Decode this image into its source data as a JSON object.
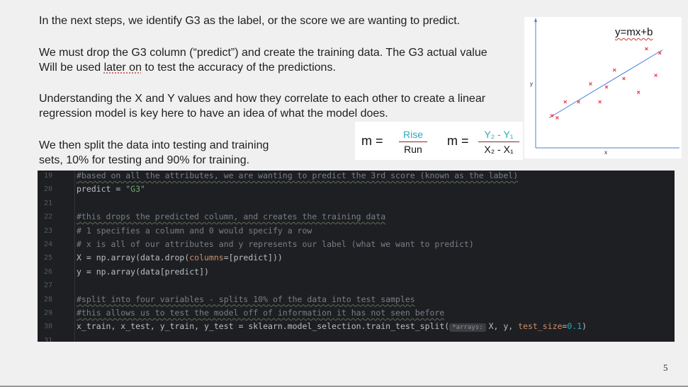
{
  "text": {
    "p1": "In the next steps, we identify G3 as the label, or the score we are wanting to predict.",
    "p2_line1": "We must drop the G3 column (“predict”) and create the training data. The G3 actual value",
    "p2_line2_a": "Will be used ",
    "p2_line2_b": "later on",
    "p2_line2_c": " to test the accuracy of the predictions.",
    "p3_line1": "Understanding the X and Y values and how they correlate to each other to create a linear",
    "p3_line2": "regression model is key here to have an idea of what the model does.",
    "p4_line1": "We then split the data into testing and training",
    "p4_line2": "sets, 10% for testing and 90% for training."
  },
  "formulas": {
    "left_lhs": "m =",
    "left_num": "Rise",
    "left_den": "Run",
    "right_lhs": "m =",
    "right_num": "Y₂ - Y₁",
    "right_den": "X₂ - X₁"
  },
  "chart": {
    "title": "y=mx+b",
    "xlabel": "x",
    "ylabel": "y",
    "point_color": "#e8293a",
    "line_color": "#4a7fd4"
  },
  "chart_data": {
    "type": "scatter",
    "title": "y=mx+b",
    "xlabel": "x",
    "ylabel": "y",
    "xlim": [
      0,
      10
    ],
    "ylim": [
      0,
      10
    ],
    "grid": false,
    "series": [
      {
        "values_x": [
          0.9,
          1.3,
          1.9,
          2.9,
          3.8,
          4.5,
          5.0,
          5.6,
          6.3,
          7.4,
          8.0,
          8.7,
          9.0
        ],
        "values_y": [
          2.7,
          2.5,
          4.0,
          4.0,
          5.7,
          4.0,
          5.4,
          7.0,
          6.2,
          4.9,
          9.0,
          6.5,
          8.6
        ]
      }
    ],
    "fit_line": {
      "x": [
        0.7,
        9.2
      ],
      "y": [
        2.5,
        8.9
      ]
    }
  },
  "code": {
    "lines": [
      {
        "n": "19",
        "parts": [
          {
            "c": "cmt-u",
            "t": "#based on all the attributes, we are wanting to predict the 3rd score (known as the label)"
          }
        ]
      },
      {
        "n": "20",
        "parts": [
          {
            "c": "",
            "t": "predict = "
          },
          {
            "c": "str",
            "t": "\"G3\""
          }
        ]
      },
      {
        "n": "21",
        "parts": []
      },
      {
        "n": "22",
        "parts": [
          {
            "c": "cmt-u",
            "t": "#this drops the predicted column, and creates the training data"
          }
        ]
      },
      {
        "n": "23",
        "parts": [
          {
            "c": "cmt",
            "t": "# 1 specifies a column and 0 would specify a row"
          }
        ]
      },
      {
        "n": "24",
        "parts": [
          {
            "c": "cmt",
            "t": "# x is all of our attributes and y represents our label (what we want to predict)"
          }
        ]
      },
      {
        "n": "25",
        "parts": [
          {
            "c": "",
            "t": "X = np.array(data.drop("
          },
          {
            "c": "kw",
            "t": "columns"
          },
          {
            "c": "",
            "t": "=[predict]))"
          }
        ]
      },
      {
        "n": "26",
        "parts": [
          {
            "c": "",
            "t": "y = np.array(data[predict])"
          }
        ]
      },
      {
        "n": "27",
        "parts": []
      },
      {
        "n": "28",
        "parts": [
          {
            "c": "cmt-u",
            "t": "#split into four variables - splits 10% of the data into test samples"
          }
        ]
      },
      {
        "n": "29",
        "parts": [
          {
            "c": "cmt-u",
            "t": "#this allows us to test the model off of information it has not seen before"
          }
        ]
      },
      {
        "n": "30",
        "parts": [
          {
            "c": "",
            "t": "x_train, x_test, y_train, y_test = sklearn.model_selection.train_test_split("
          },
          {
            "c": "hint",
            "t": "*arrays:"
          },
          {
            "c": "",
            "t": "X, y, "
          },
          {
            "c": "kw",
            "t": "test_size"
          },
          {
            "c": "",
            "t": "="
          },
          {
            "c": "num",
            "t": "0.1"
          },
          {
            "c": "",
            "t": ")"
          }
        ]
      },
      {
        "n": "31",
        "parts": []
      }
    ]
  },
  "page_number": "5"
}
